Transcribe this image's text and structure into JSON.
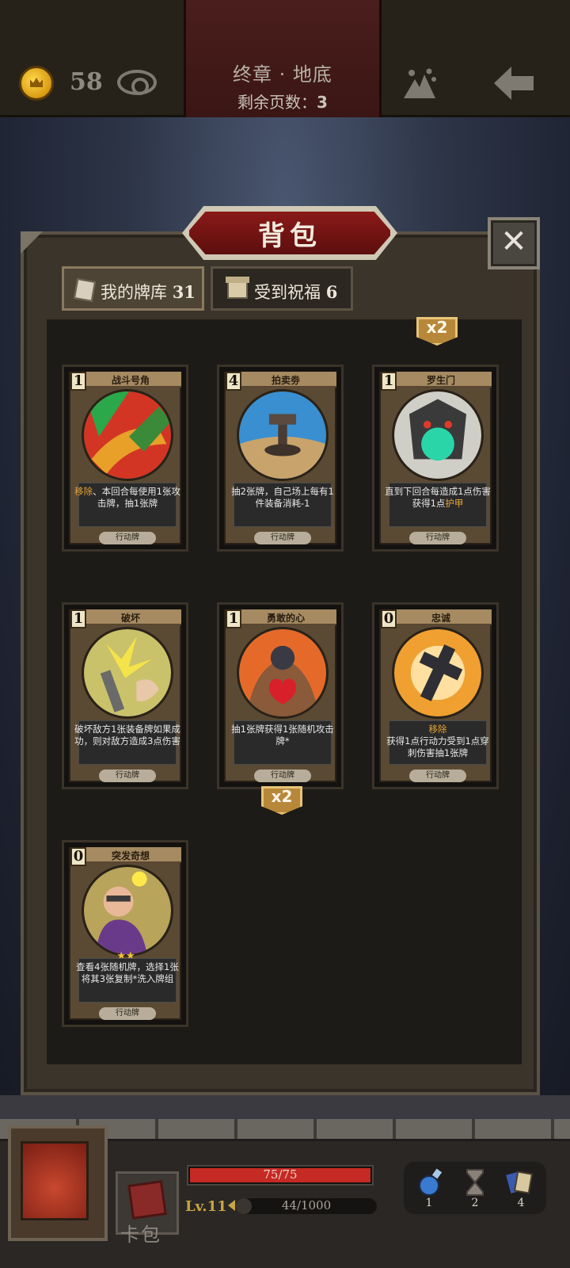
{
  "top_bar": {
    "coins": "58",
    "chapter_title": "终章 · 地底",
    "pages_left_label": "剩余页数：",
    "pages_left_value": "3"
  },
  "panel": {
    "title": "背包",
    "close_label": "✕",
    "tabs": [
      {
        "label": "我的牌库",
        "count": "31",
        "active": true
      },
      {
        "label": "受到祝福",
        "count": "6",
        "active": false
      }
    ],
    "top_multiplier": "x2"
  },
  "cards": [
    {
      "name": "战斗号角",
      "cost": "1",
      "type": "行动牌",
      "desc_hl": "移除",
      "desc": "、本回合每使用1张攻击牌，抽1张牌",
      "art": "war-horn"
    },
    {
      "name": "拍卖劵",
      "cost": "4",
      "type": "行动牌",
      "desc_hl": "",
      "desc": "抽2张牌，自己场上每有1件装备消耗-1",
      "art": "auction-gavel"
    },
    {
      "name": "罗生门",
      "cost": "1",
      "type": "行动牌",
      "desc_hl": "",
      "desc": "直到下回合每造成1点伤害获得1点",
      "desc_tail_hl": "护甲",
      "art": "rashomon-gate"
    },
    {
      "name": "破坏",
      "cost": "1",
      "type": "行动牌",
      "desc_hl": "",
      "desc": "破坏敌方1张装备牌如果成功，则对敌方造成3点伤害",
      "art": "sabotage"
    },
    {
      "name": "勇敢的心",
      "cost": "1",
      "type": "行动牌",
      "desc_hl": "",
      "desc": "抽1张牌获得1张随机攻击牌*",
      "multiplier": "x2",
      "art": "brave-heart"
    },
    {
      "name": "忠诚",
      "cost": "0",
      "type": "行动牌",
      "desc_hl": "移除",
      "desc": "获得1点行动力受到1点穿刺伤害抽1张牌",
      "art": "loyalty-cross"
    },
    {
      "name": "突发奇想",
      "cost": "0",
      "type": "行动牌",
      "desc_hl": "",
      "desc": "查看4张随机牌，选择1张将其3张复制*洗入牌组",
      "stars": "★★",
      "art": "sudden-idea"
    }
  ],
  "bottom_bar": {
    "card_bag_label": "卡包",
    "hp_text": "75/75",
    "hp_fraction": 1.0,
    "level": "Lv.11",
    "xp_text": "44/1000",
    "xp_fraction": 0.044,
    "items": [
      {
        "icon": "potion-icon",
        "count": "1"
      },
      {
        "icon": "hourglass-icon",
        "count": "2"
      },
      {
        "icon": "cards-icon",
        "count": "4"
      }
    ]
  },
  "colors": {
    "accent_red": "#c52a24",
    "gold": "#c9a442",
    "highlight_orange": "#e7a43a"
  }
}
